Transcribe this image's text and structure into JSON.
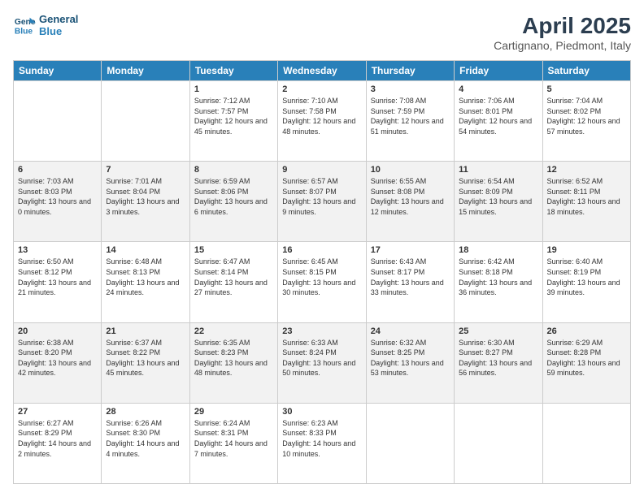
{
  "logo": {
    "line1": "General",
    "line2": "Blue"
  },
  "title": "April 2025",
  "subtitle": "Cartignano, Piedmont, Italy",
  "headers": [
    "Sunday",
    "Monday",
    "Tuesday",
    "Wednesday",
    "Thursday",
    "Friday",
    "Saturday"
  ],
  "weeks": [
    [
      {
        "day": "",
        "sunrise": "",
        "sunset": "",
        "daylight": ""
      },
      {
        "day": "",
        "sunrise": "",
        "sunset": "",
        "daylight": ""
      },
      {
        "day": "1",
        "sunrise": "Sunrise: 7:12 AM",
        "sunset": "Sunset: 7:57 PM",
        "daylight": "Daylight: 12 hours and 45 minutes."
      },
      {
        "day": "2",
        "sunrise": "Sunrise: 7:10 AM",
        "sunset": "Sunset: 7:58 PM",
        "daylight": "Daylight: 12 hours and 48 minutes."
      },
      {
        "day": "3",
        "sunrise": "Sunrise: 7:08 AM",
        "sunset": "Sunset: 7:59 PM",
        "daylight": "Daylight: 12 hours and 51 minutes."
      },
      {
        "day": "4",
        "sunrise": "Sunrise: 7:06 AM",
        "sunset": "Sunset: 8:01 PM",
        "daylight": "Daylight: 12 hours and 54 minutes."
      },
      {
        "day": "5",
        "sunrise": "Sunrise: 7:04 AM",
        "sunset": "Sunset: 8:02 PM",
        "daylight": "Daylight: 12 hours and 57 minutes."
      }
    ],
    [
      {
        "day": "6",
        "sunrise": "Sunrise: 7:03 AM",
        "sunset": "Sunset: 8:03 PM",
        "daylight": "Daylight: 13 hours and 0 minutes."
      },
      {
        "day": "7",
        "sunrise": "Sunrise: 7:01 AM",
        "sunset": "Sunset: 8:04 PM",
        "daylight": "Daylight: 13 hours and 3 minutes."
      },
      {
        "day": "8",
        "sunrise": "Sunrise: 6:59 AM",
        "sunset": "Sunset: 8:06 PM",
        "daylight": "Daylight: 13 hours and 6 minutes."
      },
      {
        "day": "9",
        "sunrise": "Sunrise: 6:57 AM",
        "sunset": "Sunset: 8:07 PM",
        "daylight": "Daylight: 13 hours and 9 minutes."
      },
      {
        "day": "10",
        "sunrise": "Sunrise: 6:55 AM",
        "sunset": "Sunset: 8:08 PM",
        "daylight": "Daylight: 13 hours and 12 minutes."
      },
      {
        "day": "11",
        "sunrise": "Sunrise: 6:54 AM",
        "sunset": "Sunset: 8:09 PM",
        "daylight": "Daylight: 13 hours and 15 minutes."
      },
      {
        "day": "12",
        "sunrise": "Sunrise: 6:52 AM",
        "sunset": "Sunset: 8:11 PM",
        "daylight": "Daylight: 13 hours and 18 minutes."
      }
    ],
    [
      {
        "day": "13",
        "sunrise": "Sunrise: 6:50 AM",
        "sunset": "Sunset: 8:12 PM",
        "daylight": "Daylight: 13 hours and 21 minutes."
      },
      {
        "day": "14",
        "sunrise": "Sunrise: 6:48 AM",
        "sunset": "Sunset: 8:13 PM",
        "daylight": "Daylight: 13 hours and 24 minutes."
      },
      {
        "day": "15",
        "sunrise": "Sunrise: 6:47 AM",
        "sunset": "Sunset: 8:14 PM",
        "daylight": "Daylight: 13 hours and 27 minutes."
      },
      {
        "day": "16",
        "sunrise": "Sunrise: 6:45 AM",
        "sunset": "Sunset: 8:15 PM",
        "daylight": "Daylight: 13 hours and 30 minutes."
      },
      {
        "day": "17",
        "sunrise": "Sunrise: 6:43 AM",
        "sunset": "Sunset: 8:17 PM",
        "daylight": "Daylight: 13 hours and 33 minutes."
      },
      {
        "day": "18",
        "sunrise": "Sunrise: 6:42 AM",
        "sunset": "Sunset: 8:18 PM",
        "daylight": "Daylight: 13 hours and 36 minutes."
      },
      {
        "day": "19",
        "sunrise": "Sunrise: 6:40 AM",
        "sunset": "Sunset: 8:19 PM",
        "daylight": "Daylight: 13 hours and 39 minutes."
      }
    ],
    [
      {
        "day": "20",
        "sunrise": "Sunrise: 6:38 AM",
        "sunset": "Sunset: 8:20 PM",
        "daylight": "Daylight: 13 hours and 42 minutes."
      },
      {
        "day": "21",
        "sunrise": "Sunrise: 6:37 AM",
        "sunset": "Sunset: 8:22 PM",
        "daylight": "Daylight: 13 hours and 45 minutes."
      },
      {
        "day": "22",
        "sunrise": "Sunrise: 6:35 AM",
        "sunset": "Sunset: 8:23 PM",
        "daylight": "Daylight: 13 hours and 48 minutes."
      },
      {
        "day": "23",
        "sunrise": "Sunrise: 6:33 AM",
        "sunset": "Sunset: 8:24 PM",
        "daylight": "Daylight: 13 hours and 50 minutes."
      },
      {
        "day": "24",
        "sunrise": "Sunrise: 6:32 AM",
        "sunset": "Sunset: 8:25 PM",
        "daylight": "Daylight: 13 hours and 53 minutes."
      },
      {
        "day": "25",
        "sunrise": "Sunrise: 6:30 AM",
        "sunset": "Sunset: 8:27 PM",
        "daylight": "Daylight: 13 hours and 56 minutes."
      },
      {
        "day": "26",
        "sunrise": "Sunrise: 6:29 AM",
        "sunset": "Sunset: 8:28 PM",
        "daylight": "Daylight: 13 hours and 59 minutes."
      }
    ],
    [
      {
        "day": "27",
        "sunrise": "Sunrise: 6:27 AM",
        "sunset": "Sunset: 8:29 PM",
        "daylight": "Daylight: 14 hours and 2 minutes."
      },
      {
        "day": "28",
        "sunrise": "Sunrise: 6:26 AM",
        "sunset": "Sunset: 8:30 PM",
        "daylight": "Daylight: 14 hours and 4 minutes."
      },
      {
        "day": "29",
        "sunrise": "Sunrise: 6:24 AM",
        "sunset": "Sunset: 8:31 PM",
        "daylight": "Daylight: 14 hours and 7 minutes."
      },
      {
        "day": "30",
        "sunrise": "Sunrise: 6:23 AM",
        "sunset": "Sunset: 8:33 PM",
        "daylight": "Daylight: 14 hours and 10 minutes."
      },
      {
        "day": "",
        "sunrise": "",
        "sunset": "",
        "daylight": ""
      },
      {
        "day": "",
        "sunrise": "",
        "sunset": "",
        "daylight": ""
      },
      {
        "day": "",
        "sunrise": "",
        "sunset": "",
        "daylight": ""
      }
    ]
  ]
}
